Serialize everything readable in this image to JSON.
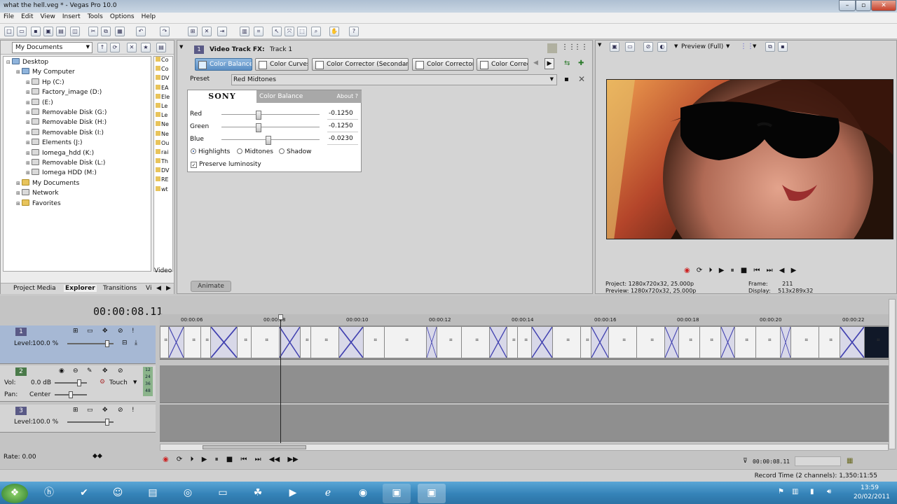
{
  "window": {
    "title": "what the hell.veg * - Vegas Pro 10.0"
  },
  "menu": [
    "File",
    "Edit",
    "View",
    "Insert",
    "Tools",
    "Options",
    "Help"
  ],
  "explorer": {
    "location": "My Documents",
    "tree": [
      {
        "label": "Desktop",
        "indent": 0,
        "icon": "desktop"
      },
      {
        "label": "My Computer",
        "indent": 1,
        "icon": "computer"
      },
      {
        "label": "Hp (C:)",
        "indent": 2,
        "icon": "drive"
      },
      {
        "label": "Factory_image (D:)",
        "indent": 2,
        "icon": "drive"
      },
      {
        "label": "(E:)",
        "indent": 2,
        "icon": "drive"
      },
      {
        "label": "Removable Disk (G:)",
        "indent": 2,
        "icon": "drive"
      },
      {
        "label": "Removable Disk (H:)",
        "indent": 2,
        "icon": "drive"
      },
      {
        "label": "Removable Disk (I:)",
        "indent": 2,
        "icon": "drive"
      },
      {
        "label": "Elements (J:)",
        "indent": 2,
        "icon": "drive"
      },
      {
        "label": "Iomega_hdd (K:)",
        "indent": 2,
        "icon": "drive"
      },
      {
        "label": "Removable Disk (L:)",
        "indent": 2,
        "icon": "drive"
      },
      {
        "label": "Iomega HDD (M:)",
        "indent": 2,
        "icon": "drive"
      },
      {
        "label": "My Documents",
        "indent": 1,
        "icon": "folder"
      },
      {
        "label": "Network",
        "indent": 1,
        "icon": "network"
      },
      {
        "label": "Favorites",
        "indent": 1,
        "icon": "folder"
      }
    ],
    "files": [
      "Co",
      "Co",
      "DV",
      "EA",
      "Ele",
      "Le",
      "Le",
      "Ne",
      "Ne",
      "Ou",
      "rai",
      "Th",
      "DV",
      "RE",
      "wt"
    ],
    "files_footer": "Video",
    "tabs": [
      "Project Media",
      "Explorer",
      "Transitions",
      "Vi"
    ]
  },
  "fx": {
    "title": "Video Track FX:",
    "track": "Track 1",
    "tabs": [
      "Color Balance",
      "Color Curves",
      "Color Corrector (Secondary)",
      "Color Corrector",
      "Color Correc"
    ],
    "preset_label": "Preset",
    "preset_value": "Red Midtones",
    "panel": {
      "brand": "SONY",
      "name": "Color Balance",
      "about": "About",
      "help": "?",
      "sliders": [
        {
          "label": "Red",
          "value": "-0.1250",
          "level": 0.375
        },
        {
          "label": "Green",
          "value": "-0.1250",
          "level": 0.375
        },
        {
          "label": "Blue",
          "value": "-0.0230",
          "level": 0.475
        }
      ],
      "modes": [
        "Highlights",
        "Midtones",
        "Shadow"
      ],
      "preserve": "Preserve luminosity"
    },
    "animate": "Animate"
  },
  "preview": {
    "mode": "Preview (Full)",
    "project_label": "Project:",
    "project": "1280x720x32, 25.000p",
    "preview_label": "Preview:",
    "preview": "1280x720x32, 25.000p",
    "frame_label": "Frame:",
    "frame": "211",
    "display_label": "Display:",
    "display": "513x289x32"
  },
  "timeline": {
    "timecode": "00:00:08.11",
    "ruler": [
      "00:00:06",
      "00:00:08",
      "00:00:10",
      "00:00:12",
      "00:00:14",
      "00:00:16",
      "00:00:18",
      "00:00:20",
      "00:00:22"
    ],
    "tracks": [
      {
        "num": "1",
        "type": "video",
        "level_label": "Level:",
        "level": "100.0 %"
      },
      {
        "num": "2",
        "type": "audio",
        "vol_label": "Vol:",
        "vol": "0.0 dB",
        "pan_label": "Pan:",
        "pan": "Center",
        "automation": "Touch"
      },
      {
        "num": "3",
        "type": "video",
        "level_label": "Level:",
        "level": "100.0 %"
      }
    ],
    "meter": [
      "12",
      "24",
      "36",
      "48"
    ],
    "rate": "Rate: 0.00",
    "cursor_time": "00:00:08.11"
  },
  "status": {
    "text": "Record Time (2 channels): 1,350:11:55"
  },
  "taskbar": {
    "time": "13:59",
    "date": "20/02/2011"
  }
}
